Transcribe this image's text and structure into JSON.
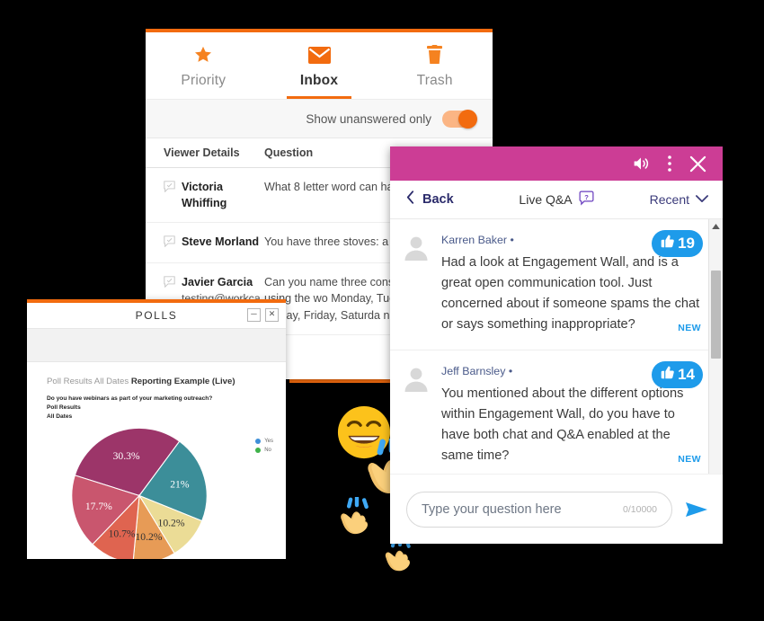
{
  "inbox": {
    "tabs": [
      {
        "label": "Priority",
        "icon": "star-icon",
        "active": false
      },
      {
        "label": "Inbox",
        "icon": "envelope-icon",
        "active": true
      },
      {
        "label": "Trash",
        "icon": "trash-icon",
        "active": false
      }
    ],
    "toolbar": {
      "toggle_label": "Show unanswered only",
      "toggle_on": true
    },
    "columns": {
      "viewer": "Viewer Details",
      "question": "Question"
    },
    "rows": [
      {
        "name": "Victoria Whiffing",
        "email": "",
        "question": "What 8 letter word can ha"
      },
      {
        "name": "Steve Morland",
        "email": "",
        "question": "You have three stoves: a g"
      },
      {
        "name": "Javier Garcia",
        "email": "testing@workcast.com",
        "question": "Can you name three cons days without using the wo Monday, Tuesday, Wedne ursday, Friday, Saturda nday?"
      }
    ]
  },
  "polls": {
    "title": "POLLS",
    "minimize_label": "─",
    "close_label": "✕",
    "report_prefix": "Poll Results All Dates ",
    "report_name": "Reporting Example (Live)",
    "question_lines": [
      "Do you have webinars as part of your marketing outreach?",
      "Poll Results",
      "All Dates"
    ]
  },
  "chart_data": {
    "type": "pie",
    "title": "Do you have webinars as part of your marketing outreach?",
    "subtitle": "Poll Results",
    "subtitle2": "All Dates",
    "categories": [
      "30.3%",
      "21%",
      "10.2%",
      "10.2%",
      "10.7%",
      "17.7%"
    ],
    "values": [
      30.3,
      21,
      10.2,
      10.2,
      10.7,
      17.7
    ],
    "labels": [
      "30.3%",
      "21%",
      "10.2%",
      "10.2%",
      "10.7%",
      "17.7%"
    ],
    "colors": [
      "#9c3569",
      "#3c8e99",
      "#ebdc96",
      "#e79b56",
      "#df6450",
      "#c9566e"
    ],
    "label_colors": [
      "#ffffff",
      "#ffffff",
      "#333333",
      "#333333",
      "#333333",
      "#ffffff"
    ],
    "legend": [
      {
        "label": "Yes",
        "color": "#3e8fd8"
      },
      {
        "label": "No",
        "color": "#3fb24a"
      }
    ],
    "legend_position": "right",
    "grid": false
  },
  "qa": {
    "topbar": {
      "volume_icon": "speaker-icon",
      "menu_icon": "kebab-menu-icon",
      "close_icon": "close-icon"
    },
    "back_label": "Back",
    "title": "Live Q&A",
    "help_icon": "question-mark-icon",
    "sort_label": "Recent",
    "messages": [
      {
        "name": "Karren Baker •",
        "text": "Had a look at Engagement Wall, and is a great open communication tool. Just concerned about if someone spams the chat or says something inappropriate?",
        "likes": "19",
        "badge": "NEW"
      },
      {
        "name": "Jeff Barnsley •",
        "text": "You mentioned about the different options within Engagement Wall, do you have to have both chat and Q&A enabled at the same time?",
        "likes": "14",
        "badge": "NEW"
      }
    ],
    "input": {
      "placeholder": "Type your question here",
      "counter": "0/10000",
      "send_icon": "send-icon"
    }
  },
  "emoji": {
    "smile": "grinning-face-icon",
    "clap": "clapping-hands-icon"
  },
  "colors": {
    "accent_orange": "#f26b0f",
    "qa_pink": "#cc3d95",
    "like_blue": "#1e9bea",
    "background": "#000000"
  }
}
